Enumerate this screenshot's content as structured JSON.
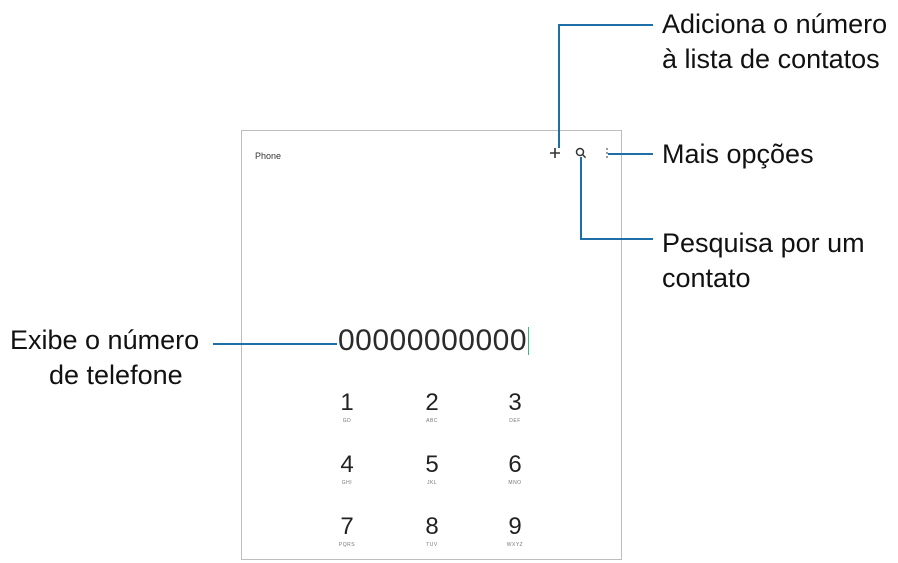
{
  "app": {
    "title": "Phone"
  },
  "toolbar": {
    "add_icon": "plus-icon",
    "search_icon": "search-icon",
    "more_icon": "more-vertical-icon"
  },
  "display": {
    "number": "00000000000"
  },
  "keypad": [
    {
      "digit": "1",
      "letters": "GD"
    },
    {
      "digit": "2",
      "letters": "ABC"
    },
    {
      "digit": "3",
      "letters": "DEF"
    },
    {
      "digit": "4",
      "letters": "GHI"
    },
    {
      "digit": "5",
      "letters": "JKL"
    },
    {
      "digit": "6",
      "letters": "MNO"
    },
    {
      "digit": "7",
      "letters": "PQRS"
    },
    {
      "digit": "8",
      "letters": "TUV"
    },
    {
      "digit": "9",
      "letters": "WXYZ"
    }
  ],
  "callouts": {
    "add_line1": "Adiciona o número",
    "add_line2": "à lista de contatos",
    "more": "Mais opções",
    "search_line1": "Pesquisa por um",
    "search_line2": "contato",
    "number_line1": "Exibe o número",
    "number_line2": "de telefone"
  },
  "colors": {
    "callout_line": "#1e6fa8",
    "cursor": "#3cb878"
  }
}
